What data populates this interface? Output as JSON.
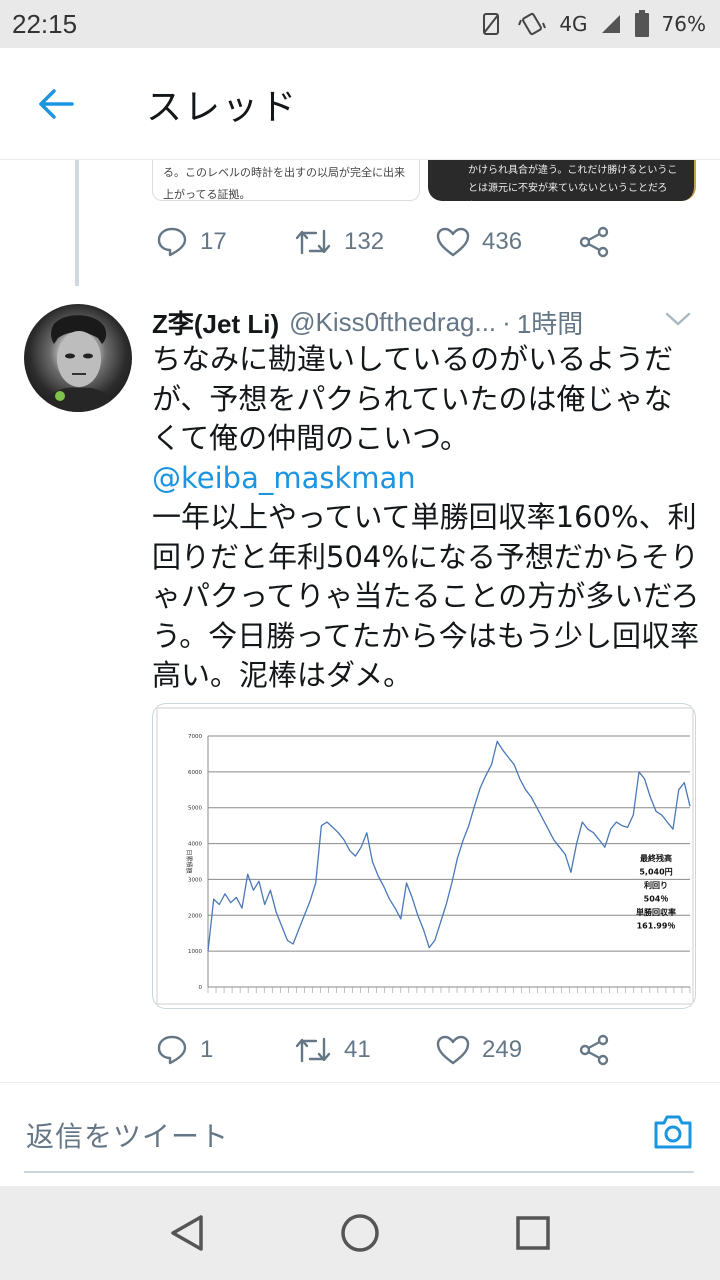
{
  "status_bar": {
    "time": "22:15",
    "network": "4G",
    "battery": "76%"
  },
  "app_bar": {
    "title": "スレッド"
  },
  "previous_tweet": {
    "media_left_text": "る。このレベルの時計を出すの以局が完全に出来上がってる証拠。",
    "media_right_text": "かけられ具合が違う。これだけ勝けるということは源元に不安が来ていないということだろう。",
    "reply_count": "17",
    "retweet_count": "132",
    "like_count": "436"
  },
  "tweet": {
    "name": "Z李(Jet Li)",
    "handle": "@Kiss0fthedrag...",
    "separator": "·",
    "time": "1時間",
    "text_1": "ちなみに勘違いしているのがいるようだが、予想をパクられていたのは俺じゃなくて俺の仲間のこいつ。",
    "mention": "@keiba_maskman",
    "text_2": "一年以上やっていて単勝回収率160%、利回りだと年利504%になる予想だからそりゃパクってりゃ当たることの方が多いだろう。今日勝ってたから今はもう少し回収率高い。泥棒はダメ。",
    "reply_count": "1",
    "retweet_count": "41",
    "like_count": "249"
  },
  "chart_data": {
    "type": "line",
    "ylabel": "日累積額",
    "ylim": [
      0,
      7000
    ],
    "yticks": [
      "0",
      "1000",
      "2000",
      "3000",
      "4000",
      "5000",
      "6000",
      "7000"
    ],
    "series_color": "#4a78b8",
    "values": [
      1000,
      2450,
      2300,
      2600,
      2350,
      2500,
      2200,
      3150,
      2700,
      2950,
      2300,
      2700,
      2100,
      1700,
      1300,
      1200,
      1600,
      2000,
      2400,
      2900,
      4500,
      4600,
      4450,
      4300,
      4100,
      3800,
      3650,
      3900,
      4300,
      3500,
      3100,
      2800,
      2450,
      2200,
      1900,
      2900,
      2500,
      2000,
      1600,
      1100,
      1300,
      1800,
      2300,
      2900,
      3600,
      4100,
      4500,
      5050,
      5550,
      5900,
      6200,
      6850,
      6600,
      6400,
      6200,
      5800,
      5500,
      5300,
      5000,
      4700,
      4400,
      4100,
      3900,
      3700,
      3200,
      4000,
      4600,
      4400,
      4300,
      4100,
      3900,
      4400,
      4600,
      4500,
      4450,
      4800,
      6000,
      5800,
      5300,
      4900,
      4800,
      4600,
      4400,
      5500,
      5700,
      5040
    ],
    "annotation": [
      "最終残高",
      "5,040円",
      "利回り",
      "504％",
      "単勝回収率",
      "161.99％"
    ]
  },
  "composer": {
    "placeholder": "返信をツイート"
  }
}
